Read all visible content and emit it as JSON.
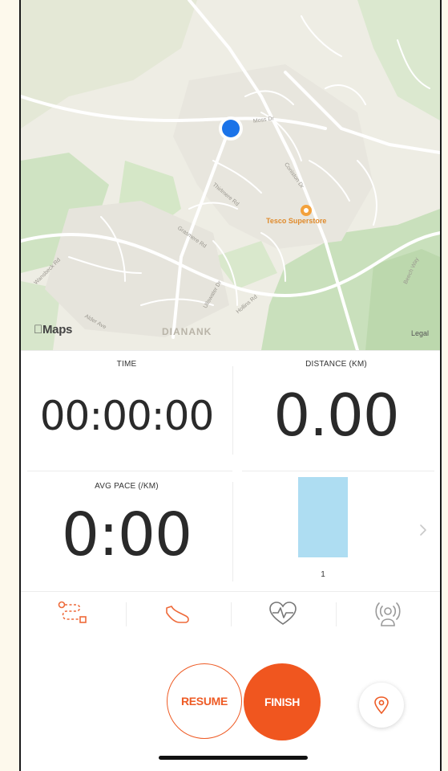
{
  "map": {
    "provider_logo": "Maps",
    "legal_label": "Legal",
    "area_label": "DIANANK",
    "poi_label": "Tesco Superstore",
    "streets": [
      "Moss Dr",
      "Coniston Dr",
      "Thirlmere Rd",
      "Grasmere Rd",
      "Wansbeck Rd",
      "Alder Ave",
      "Ullswater Dr",
      "Hollins Rd",
      "Beech Way"
    ]
  },
  "stats": {
    "time": {
      "label": "TIME",
      "value": "00:00:00"
    },
    "distance": {
      "label": "DISTANCE (KM)",
      "value": "0.00"
    },
    "avg_pace": {
      "label": "AVG PACE (/KM)",
      "value": "0:00"
    },
    "split_chart": {
      "tick_label": "1"
    }
  },
  "chart_data": {
    "type": "bar",
    "categories": [
      "1"
    ],
    "values": [
      1
    ],
    "title": "",
    "xlabel": "",
    "ylabel": ""
  },
  "icon_bar": [
    "route-icon",
    "shoe-icon",
    "heart-rate-icon",
    "sensor-icon"
  ],
  "actions": {
    "resume_label": "RESUME",
    "finish_label": "FINISH"
  },
  "colors": {
    "accent": "#f0561f",
    "chart_bar": "#aeddf2",
    "location_dot": "#1a73e8"
  }
}
